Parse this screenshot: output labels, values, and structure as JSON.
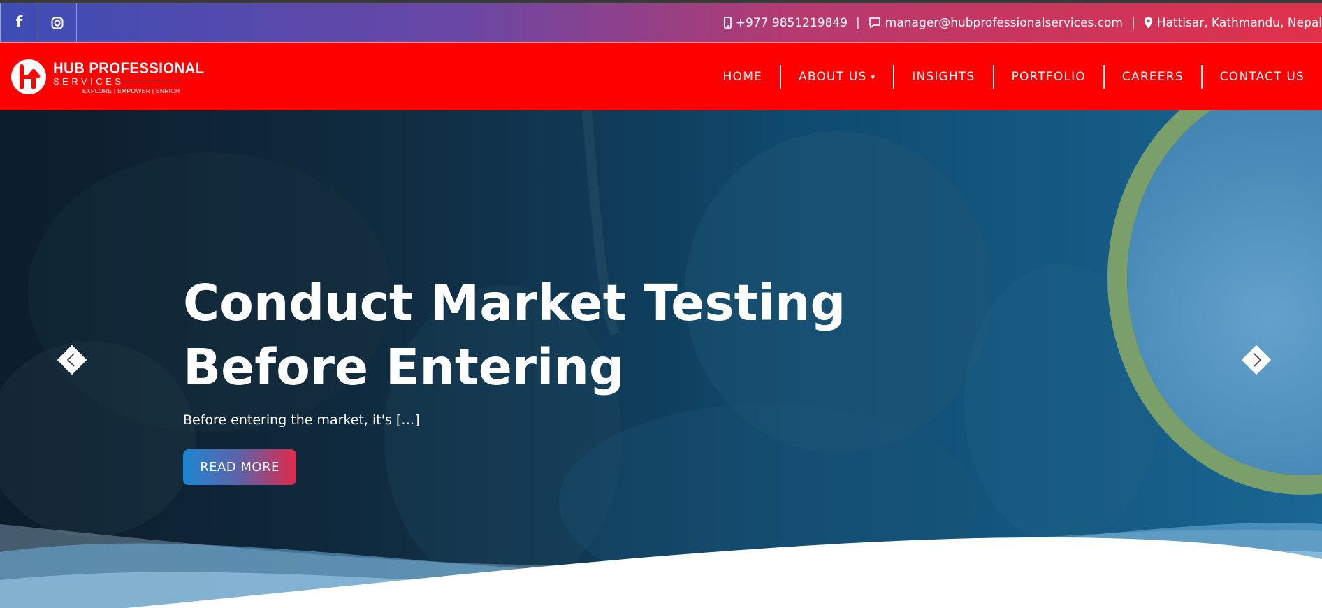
{
  "topbar": {
    "phone": "+977 9851219849",
    "email": "manager@hubprofessionalservices.com",
    "address": "Hattisar, Kathmandu, Nepal",
    "separator": "|",
    "socials": [
      {
        "name": "facebook",
        "icon": "facebook-icon"
      },
      {
        "name": "instagram",
        "icon": "instagram-icon"
      }
    ]
  },
  "logo": {
    "title": "HUB PROFESSIONAL",
    "subtitle": "SERVICES",
    "tagline": "EXPLORE | EMPOWER | ENRICH"
  },
  "nav": {
    "items": [
      {
        "label": "HOME"
      },
      {
        "label": "ABOUT US",
        "caret": "▾"
      },
      {
        "label": "INSIGHTS"
      },
      {
        "label": "PORTFOLIO"
      },
      {
        "label": "CAREERS"
      },
      {
        "label": "CONTACT US"
      }
    ]
  },
  "hero": {
    "title": "Conduct Market Testing Before Entering",
    "description": "Before entering the market, it's […]",
    "button_label": "READ MORE"
  },
  "colors": {
    "navbar": "#ff0000",
    "topbar_start": "#3d4db5",
    "topbar_end": "#e0314a",
    "ring": "#7a9f6a"
  }
}
